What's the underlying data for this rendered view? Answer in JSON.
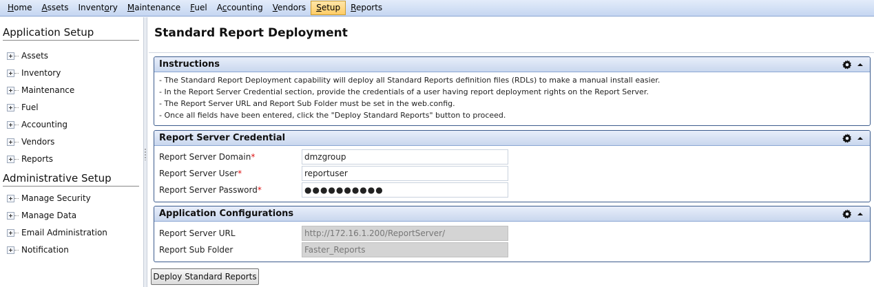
{
  "topmenu": {
    "items": [
      {
        "pre": "",
        "ul": "H",
        "post": "ome"
      },
      {
        "pre": "",
        "ul": "A",
        "post": "ssets"
      },
      {
        "pre": "Invent",
        "ul": "o",
        "post": "ry"
      },
      {
        "pre": "",
        "ul": "M",
        "post": "aintenance"
      },
      {
        "pre": "",
        "ul": "F",
        "post": "uel"
      },
      {
        "pre": "A",
        "ul": "c",
        "post": "counting"
      },
      {
        "pre": "",
        "ul": "V",
        "post": "endors"
      },
      {
        "pre": "",
        "ul": "S",
        "post": "etup"
      },
      {
        "pre": "",
        "ul": "R",
        "post": "eports"
      }
    ]
  },
  "sidebar": {
    "app_setup_heading": "Application Setup",
    "app_items": [
      "Assets",
      "Inventory",
      "Maintenance",
      "Fuel",
      "Accounting",
      "Vendors",
      "Reports"
    ],
    "admin_setup_heading": "Administrative Setup",
    "admin_items": [
      "Manage Security",
      "Manage Data",
      "Email Administration",
      "Notification"
    ]
  },
  "main": {
    "title": "Standard Report Deployment",
    "instructions": {
      "title": "Instructions",
      "lines": [
        "- The Standard Report Deployment capability will deploy all Standard Reports definition files (RDLs) to make a manual install easier.",
        "- In the Report Server Credential section, provide the credentials of a user having report deployment rights on the Report Server.",
        "- The Report Server URL and Report Sub Folder must be set in the web.config.",
        "- Once all fields have been entered, click the \"Deploy Standard Reports\" button to proceed."
      ]
    },
    "credential": {
      "title": "Report Server Credential",
      "domain_label": "Report Server Domain",
      "domain_value": "dmzgroup",
      "user_label": "Report Server User",
      "user_value": "reportuser",
      "password_label": "Report Server Password",
      "password_value": "●●●●●●●●●●",
      "required_mark": "*"
    },
    "appconfig": {
      "title": "Application Configurations",
      "url_label": "Report Server URL",
      "url_value": "http://172.16.1.200/ReportServer/",
      "folder_label": "Report Sub Folder",
      "folder_value": "Faster_Reports"
    },
    "deploy_button_label": "Deploy Standard Reports"
  },
  "icons": {
    "gear": "gear-icon",
    "collapse": "chevron-up-icon",
    "expander": "plus-box-icon"
  },
  "colors": {
    "menu_active": "#ffcc66",
    "panel_border": "#3a5a8c",
    "required": "#dd1111"
  }
}
